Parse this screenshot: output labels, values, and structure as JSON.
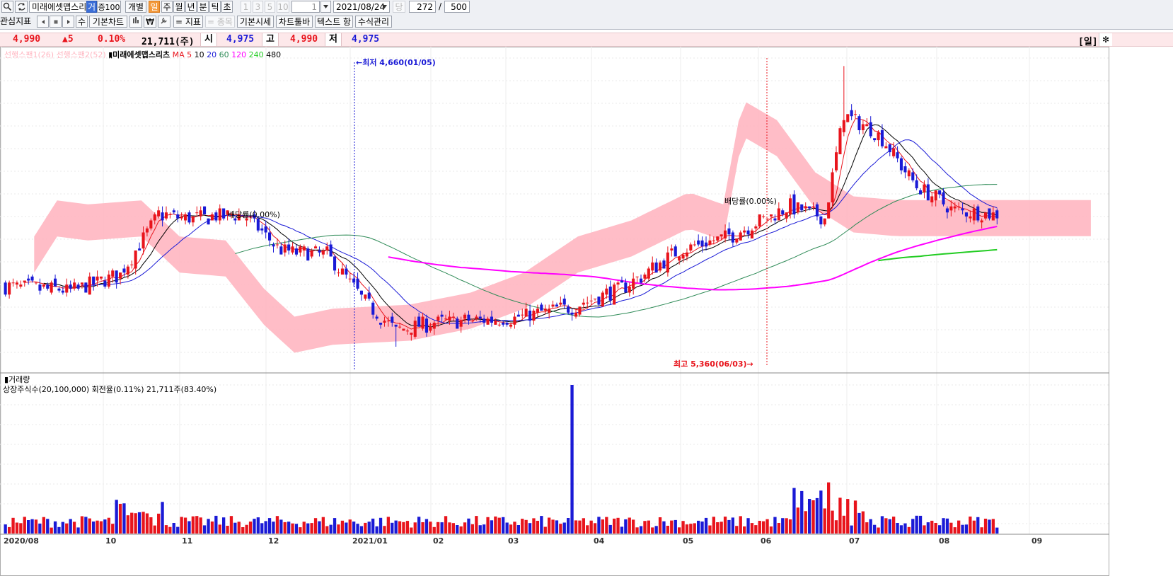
{
  "toolbar": {
    "stock_name": "미래에셋맵스리",
    "tag_geo": "거",
    "tag_jeung": "증100",
    "gaebyeol": "개별",
    "periods": [
      "일",
      "주",
      "월",
      "년",
      "분",
      "틱",
      "초"
    ],
    "active_period": "일",
    "minute_buttons": [
      "1",
      "3",
      "5",
      "10"
    ],
    "interval_value": "1",
    "date_value": "2021/08/24",
    "dang": "당",
    "count_value": "272",
    "slash": "/",
    "total_value": "500",
    "row2": {
      "gwansim": "관심지표",
      "su": "수",
      "basic_chart": "기본차트",
      "jipyo": "= 지표",
      "jongmok": "= 종목",
      "basic_quote": "기본시세",
      "chart_toolbar": "차트툴바",
      "text_label": "텍스트 항",
      "formula": "수식관리"
    }
  },
  "quote": {
    "price": "4,990",
    "change": "▲5",
    "rate": "0.10%",
    "volume": "21,711(주)",
    "open_label": "시",
    "open": "4,975",
    "high_label": "고",
    "high": "4,990",
    "low_label": "저",
    "low": "4,975",
    "right_label": "[일]"
  },
  "colors": {
    "up": "#e8141c",
    "down": "#1a1ad6",
    "ma5": "#e8141c",
    "ma10": "#000000",
    "ma20": "#1a1ad6",
    "ma60": "#2e8b57",
    "ma120": "#ff00ff",
    "ma240": "#22cc22",
    "cloud": "#ffb6c1"
  },
  "legend": {
    "span1": "선행스팬1(26)",
    "span2": "선행스팬2(52)",
    "name": "▮미래에셋맵스리츠",
    "ma_prefix": "MA",
    "ma5": "5",
    "ma10": "10",
    "ma20": "20",
    "ma60": "60",
    "ma120": "120",
    "ma240": "240",
    "ma480": "480"
  },
  "annotations": {
    "low": "←최저 4,660(01/05)",
    "high": "최고 5,360(06/03)→",
    "dividend1": "배당률(0.00%)",
    "dividend2": "배당률(0.00%)"
  },
  "volume_panel": {
    "title": "▮거래량",
    "info": "상장주식수(20,100,000) 회전율(0.11%) 21,711주(83.40%)"
  },
  "chart_data": {
    "type": "candlestick",
    "title": "미래에셋맵스리츠",
    "period": "daily",
    "x_tick_labels": [
      "2020/08",
      "10",
      "11",
      "12",
      "2021/01",
      "02",
      "03",
      "04",
      "05",
      "06",
      "07",
      "08",
      "09"
    ],
    "price_anchors": [
      {
        "date": "2020/08",
        "close": 4810
      },
      {
        "date": "2020/10",
        "close": 4800
      },
      {
        "date": "2020/10 mid",
        "close": 4840
      },
      {
        "date": "2020/11",
        "close": 4990
      },
      {
        "date": "2020/12",
        "close": 4980
      },
      {
        "date": "2020/12 mid",
        "close": 4900
      },
      {
        "date": "2021/01/05",
        "low": 4660,
        "close": 4720
      },
      {
        "date": "2021/02",
        "close": 4730
      },
      {
        "date": "2021/03",
        "close": 4760
      },
      {
        "date": "2021/04",
        "close": 4910
      },
      {
        "date": "2021/05",
        "close": 5010
      },
      {
        "date": "2021/06/03",
        "high": 5360,
        "close": 5240
      },
      {
        "date": "2021/07",
        "close": 5050
      },
      {
        "date": "2021/08",
        "close": 4990
      },
      {
        "date": "2021/08/24",
        "open": 4975,
        "high": 4990,
        "low": 4975,
        "close": 4990
      }
    ],
    "extremes": {
      "low": 4660,
      "low_date": "01/05",
      "high": 5360,
      "high_date": "06/03"
    },
    "last": {
      "close": 4990,
      "change": 5,
      "change_rate_pct": 0.1,
      "volume": 21711
    },
    "volume_spike": {
      "month": "2021/03 late",
      "note": "largest volume bar"
    },
    "moving_averages": [
      "5",
      "10",
      "20",
      "60",
      "120",
      "240",
      "480"
    ],
    "ichimoku": [
      "선행스팬1(26)",
      "선행스팬2(52)"
    ]
  }
}
